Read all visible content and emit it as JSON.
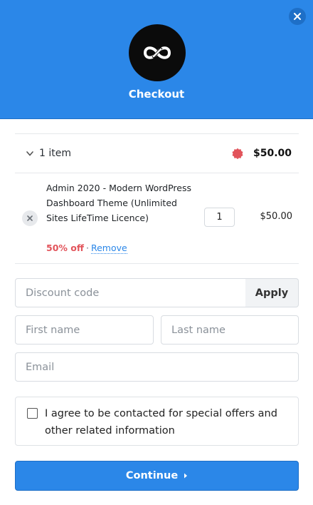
{
  "header": {
    "title": "Checkout",
    "logo_icon": "infinity-link-logo-icon",
    "close_icon": "close-icon",
    "color": "#2b87e8"
  },
  "summary": {
    "item_count": "1 item",
    "total": "$50.00",
    "badge_icon": "sale-badge-icon",
    "badge_color": "#e2545b"
  },
  "line_item": {
    "name": "Admin 2020 - Modern WordPress Dashboard Theme (Unlimited Sites LifeTime Licence)",
    "discount": "50% off",
    "separator": "·",
    "remove_label": "Remove",
    "quantity": "1",
    "price": "$50.00"
  },
  "form": {
    "discount_placeholder": "Discount code",
    "apply_label": "Apply",
    "first_name_placeholder": "First name",
    "last_name_placeholder": "Last name",
    "email_placeholder": "Email",
    "consent_text": "I agree to be contacted for special offers and other related information",
    "continue_label": "Continue"
  }
}
